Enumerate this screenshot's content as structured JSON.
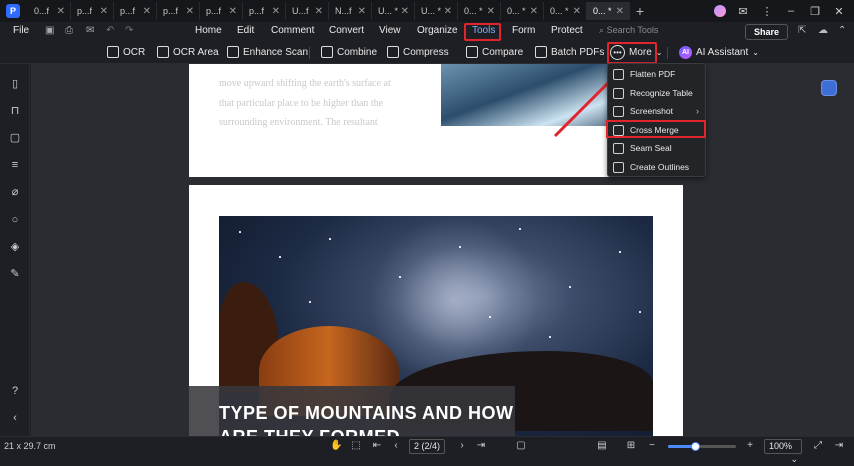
{
  "app": {
    "accent_color": "#2f6bff",
    "highlight_color": "#e0262c"
  },
  "tabs": [
    {
      "label": "0...f"
    },
    {
      "label": "p...f"
    },
    {
      "label": "p...f"
    },
    {
      "label": "p...f"
    },
    {
      "label": "p...f"
    },
    {
      "label": "p...f"
    },
    {
      "label": "U...f"
    },
    {
      "label": "N...f"
    },
    {
      "label": "U... *"
    },
    {
      "label": "U... *"
    },
    {
      "label": "0... *"
    },
    {
      "label": "0... *"
    },
    {
      "label": "0... *"
    },
    {
      "label": "0... *"
    }
  ],
  "menubar": {
    "file": "File",
    "items": [
      "Home",
      "Edit",
      "Comment",
      "Convert",
      "View",
      "Organize",
      "Tools",
      "Form",
      "Protect"
    ],
    "search_placeholder": "Search Tools",
    "share": "Share"
  },
  "toolbar": {
    "ocr": "OCR",
    "ocr_area": "OCR Area",
    "enhance_scan": "Enhance Scan",
    "combine": "Combine",
    "compress": "Compress",
    "compare": "Compare",
    "batch_pdfs": "Batch PDFs",
    "more": "More",
    "ai_badge": "AI",
    "ai_assistant": "AI Assistant"
  },
  "dropdown": {
    "items": [
      {
        "label": "Flatten PDF",
        "icon": "flatten-icon"
      },
      {
        "label": "Recognize Table",
        "icon": "table-icon"
      },
      {
        "label": "Screenshot",
        "icon": "screenshot-icon",
        "submenu": true
      },
      {
        "label": "Cross Merge",
        "icon": "cross-merge-icon"
      },
      {
        "label": "Seam Seal",
        "icon": "seal-icon"
      },
      {
        "label": "Create Outlines",
        "icon": "outline-icon"
      }
    ]
  },
  "document": {
    "page1_lines": [
      "move upward shifting the earth's surface at",
      "that particular place to be higher than the",
      "surrounding environment. The resultant"
    ],
    "page2_title_line1": "TYPE OF MOUNTAINS AND HOW",
    "page2_title_line2": "ARE THEY FORMED"
  },
  "statusbar": {
    "page_size": "21 x 29.7 cm",
    "page_indicator": "2 (2/4)",
    "zoom": "100%",
    "zoom_level": 0.4
  }
}
